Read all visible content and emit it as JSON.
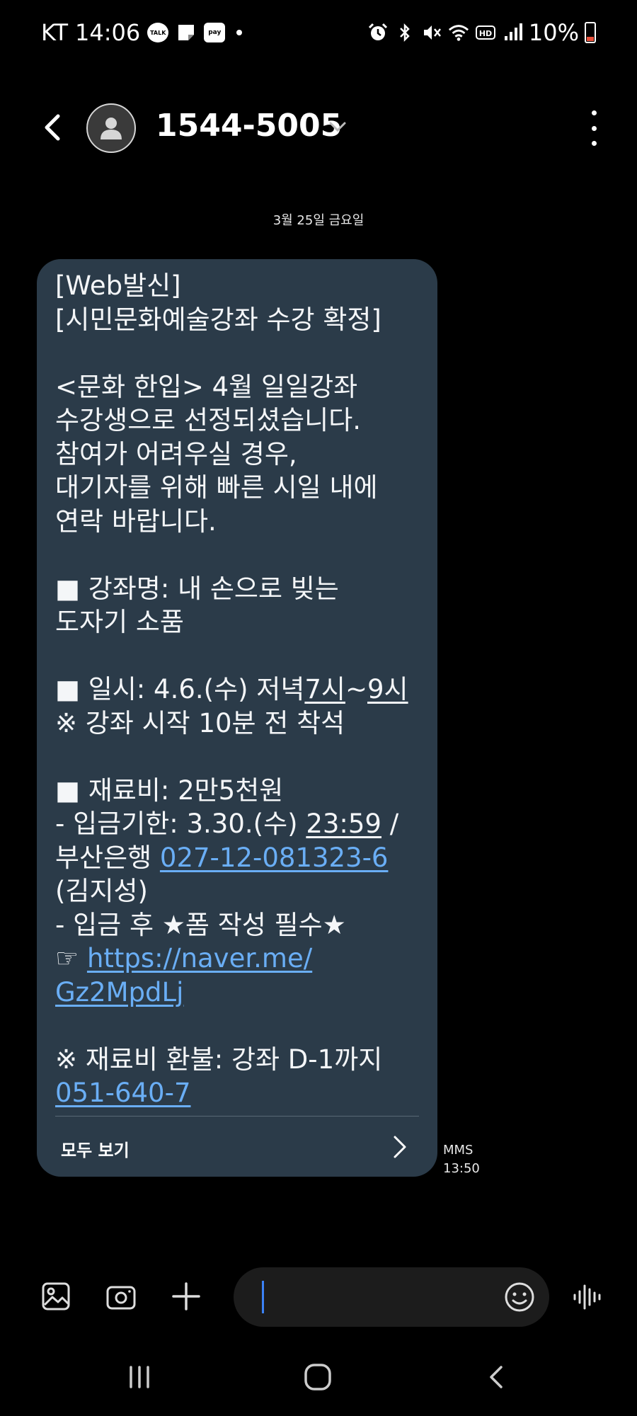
{
  "status_bar": {
    "carrier": "KT",
    "time": "14:06",
    "talk_badge": "TALK",
    "pay_badge": "pay",
    "battery_percent": "10%",
    "battery_level": 0.1,
    "battery_color": "#e8503a"
  },
  "header": {
    "contact_name": "1544-5005"
  },
  "date_separator": "3월 25일 금요일",
  "message": {
    "lines": {
      "l1": "[Web발신]",
      "l2": "[시민문화예술강좌 수강 확정]",
      "l3": "<문화 한입> 4월 일일강좌",
      "l4": "수강생으로 선정되셨습니다.",
      "l5": "참여가 어려우실 경우,",
      "l6": "대기자를 위해 빠른 시일 내에",
      "l7": "연락 바랍니다.",
      "l8": "■ 강좌명: 내 손으로 빚는",
      "l9": "도자기 소품",
      "l10a": "■ 일시: 4.6.(수) 저녁",
      "l10b": "7시",
      "l10c": "~",
      "l10d": "9시",
      "l11": "※ 강좌 시작 10분 전 착석",
      "l12": "■ 재료비: 2만5천원",
      "l13a": "- 입금기한: 3.30.(수) ",
      "l13b": "23:59",
      "l13c": " /",
      "l14a": "부산은행 ",
      "l14b": "027-12-081323-6",
      "l15": "(김지성)",
      "l16": "- 입금 후 ★폼 작성 필수★",
      "l17a": "☞ ",
      "l17b": "https://naver.me/",
      "l18": "Gz2MpdLj",
      "l19": "※ 재료비 환불: 강좌 D-1까지",
      "l20": "051-640-7"
    },
    "view_all_label": "모두 보기",
    "type": "MMS",
    "time": "13:50",
    "bubble_color": "#2b3b49",
    "link_color": "#6aaef5"
  },
  "input_bar": {
    "caret_color": "#3b82f6"
  }
}
